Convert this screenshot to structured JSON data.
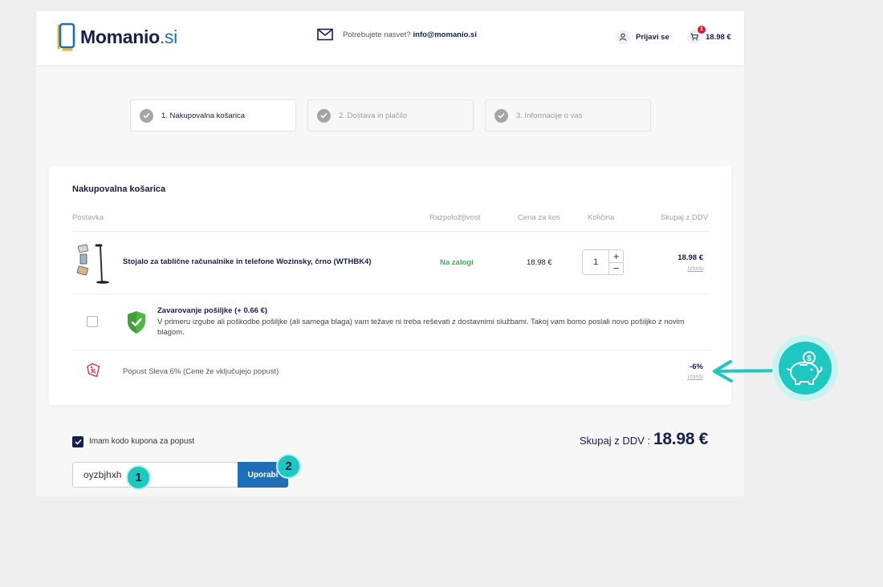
{
  "header": {
    "logo_main": "Momanio",
    "logo_tld": ".si",
    "help_text": "Potrebujete nasvet?",
    "help_email": "info@momanio.si",
    "login_label": "Prijavi se",
    "cart_count": "1",
    "cart_total": "18.98 €"
  },
  "steps": [
    {
      "label": "1. Nakupovalna košarica"
    },
    {
      "label": "2. Dostava in plačilo"
    },
    {
      "label": "3. Informacije o vas"
    }
  ],
  "cart": {
    "title": "Nakupovalna košarica",
    "columns": {
      "item": "Postavka",
      "availability": "Razpoložljivost",
      "unit_price": "Cena za kos",
      "quantity": "Količina",
      "total": "Skupaj z DDV"
    },
    "product": {
      "name": "Stojalo za tablične računalnike in telefone Wozinsky, črno (WTHBK4)",
      "availability": "Na zalogi",
      "unit_price": "18.98 €",
      "quantity": "1",
      "total": "18.98 €",
      "delete_label": "Izbriši"
    },
    "insurance": {
      "title": "Zavarovanje pošiljke (+ 0.66 €)",
      "description": "V primeru izgube ali poškodbe pošiljke (ali samega blaga) vam težave ni treba reševati z dostavnimi službami. Takoj vam bomo poslali novo pošiljko z novim blagom."
    },
    "discount": {
      "label": "Popust Sleva 6% (Cene že vključujejo popust)",
      "value": "-6%",
      "delete_label": "Izbriši"
    }
  },
  "coupon": {
    "checkbox_label": "Imam kodo kupona za popust",
    "value": "oyzbjhxh",
    "button_label": "Uporabi"
  },
  "summary": {
    "label": "Skupaj z DDV :",
    "value": "18.98 €"
  },
  "annotations": {
    "marker_1": "1",
    "marker_2": "2"
  },
  "colors": {
    "brand_navy": "#16204a",
    "brand_blue": "#1f6fb8",
    "accent_teal": "#1ec7c0",
    "stock_green": "#34b35a",
    "badge_red": "#e0192e"
  }
}
